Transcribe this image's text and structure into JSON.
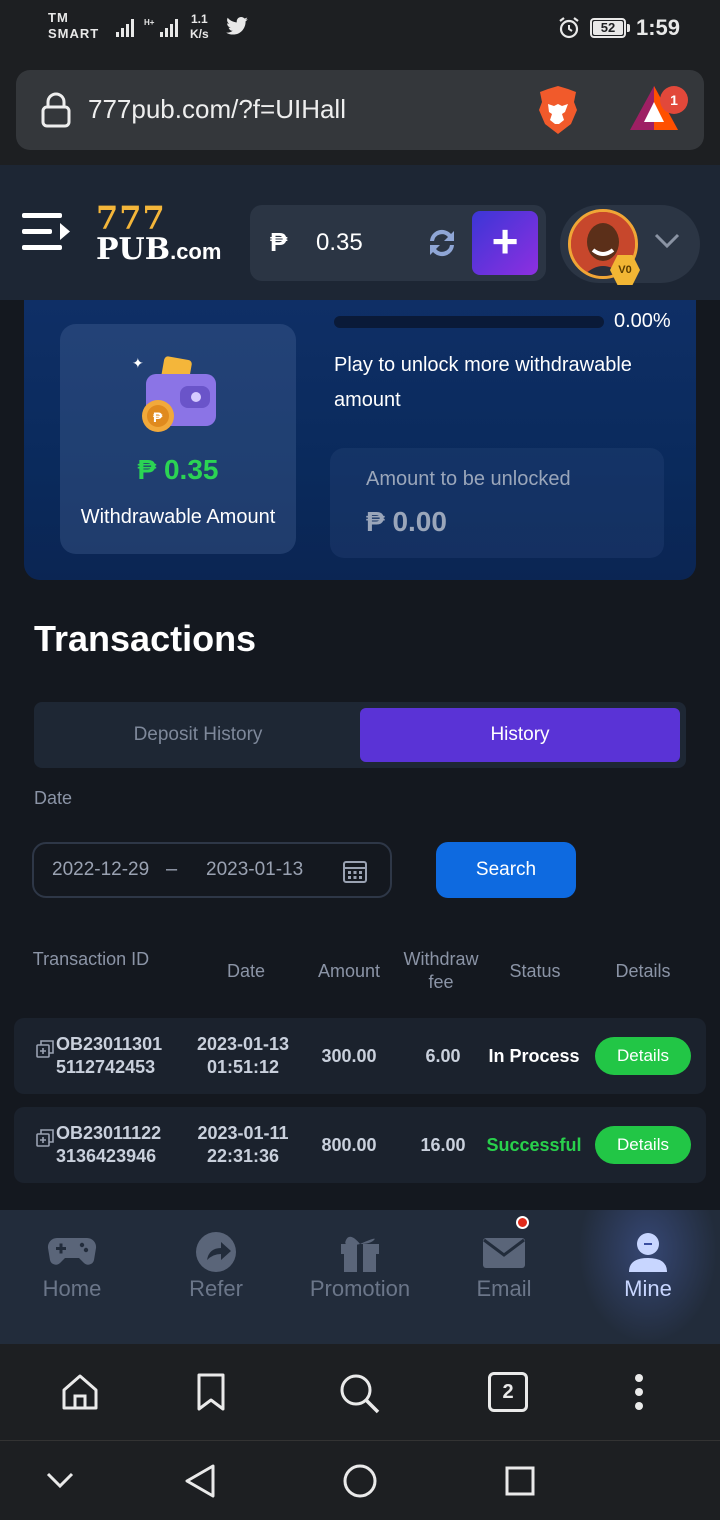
{
  "status_bar": {
    "carrier_line1": "TM",
    "carrier_line2": "SMART",
    "speed_value": "1.1",
    "speed_unit": "K/s",
    "battery": "52",
    "time": "1:59"
  },
  "browser": {
    "url": "777pub.com/?f=UIHall",
    "rewards_badge": "1",
    "tabs_count": "2"
  },
  "header": {
    "logo_top": "777",
    "logo_bottom": "PUB",
    "logo_suffix": ".com",
    "currency": "₱",
    "balance": "0.35",
    "vip_label": "V0"
  },
  "wallet": {
    "withdrawable_amount": "₱ 0.35",
    "withdrawable_label": "Withdrawable Amount",
    "progress_percent": "0.00%",
    "progress_value": 0,
    "unlock_message": "Play to unlock more withdrawable amount",
    "to_unlock_label": "Amount to be unlocked",
    "to_unlock_amount": "₱ 0.00"
  },
  "transactions": {
    "title": "Transactions",
    "tabs": [
      "Deposit History",
      "History"
    ],
    "active_tab": "History",
    "date_label": "Date",
    "date_from": "2022-12-29",
    "date_separator": "–",
    "date_to": "2023-01-13",
    "search_label": "Search",
    "columns": {
      "id": "Transaction ID",
      "date": "Date",
      "amount": "Amount",
      "fee": "Withdraw fee",
      "status": "Status",
      "details": "Details"
    },
    "rows": [
      {
        "id_line1": "OB23011301",
        "id_line2": "5112742453",
        "date_line1": "2023-01-13",
        "date_line2": "01:51:12",
        "amount": "300.00",
        "fee": "6.00",
        "status": "In Process",
        "details": "Details"
      },
      {
        "id_line1": "OB23011122",
        "id_line2": "3136423946",
        "date_line1": "2023-01-11",
        "date_line2": "22:31:36",
        "amount": "800.00",
        "fee": "16.00",
        "status": "Successful",
        "details": "Details"
      }
    ]
  },
  "app_nav": [
    {
      "label": "Home",
      "icon": "gamepad-icon"
    },
    {
      "label": "Refer",
      "icon": "share-icon"
    },
    {
      "label": "Promotion",
      "icon": "gift-icon"
    },
    {
      "label": "Email",
      "icon": "mail-icon"
    },
    {
      "label": "Mine",
      "icon": "user-icon"
    }
  ],
  "colors": {
    "accent_purple": "#5a33d6",
    "success_green": "#29d14c",
    "search_blue": "#0e6ae0",
    "logo_gold": "#f4b63a"
  }
}
